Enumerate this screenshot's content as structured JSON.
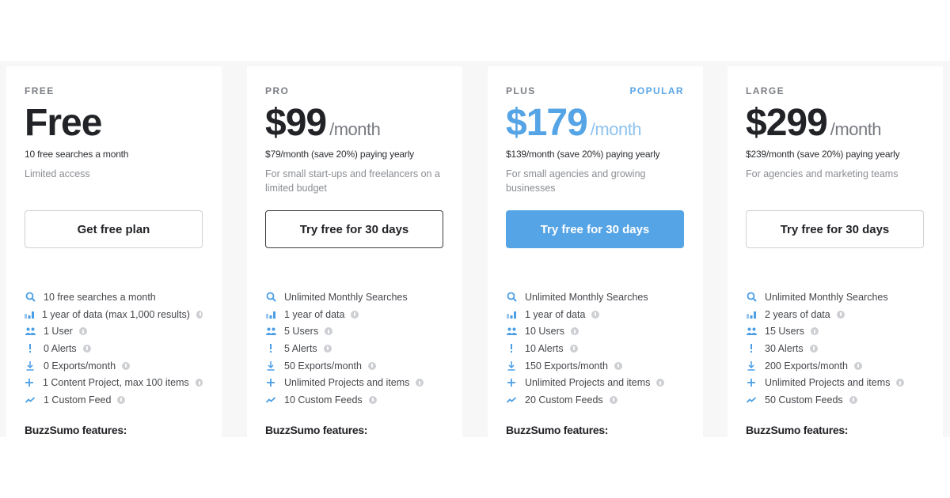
{
  "colors": {
    "accent": "#55a4e6",
    "text_dark": "#222327",
    "text_muted": "#8a8d93",
    "band_bg": "#f7f7f8"
  },
  "plans": [
    {
      "tier": "FREE",
      "price": "Free",
      "per": "",
      "yearly": "10 free searches a month",
      "description": "Limited access",
      "cta": "Get free plan",
      "features": [
        {
          "icon": "search-icon",
          "text": "10 free searches a month",
          "info": false
        },
        {
          "icon": "bar-chart-icon",
          "text": "1 year of data (max 1,000 results)",
          "info": true
        },
        {
          "icon": "users-icon",
          "text": "1 User",
          "info": true
        },
        {
          "icon": "exclamation-icon",
          "text": "0 Alerts",
          "info": true
        },
        {
          "icon": "download-icon",
          "text": "0 Exports/month",
          "info": true
        },
        {
          "icon": "plus-icon",
          "text": "1 Content Project, max 100 items",
          "info": true
        },
        {
          "icon": "trend-icon",
          "text": "1 Custom Feed",
          "info": true
        }
      ],
      "features_heading": "BuzzSumo features:"
    },
    {
      "tier": "PRO",
      "price": "$99",
      "per": "/month",
      "yearly": "$79/month (save 20%) paying yearly",
      "description": "For small start-ups and freelancers on a limited budget",
      "cta": "Try free for 30 days",
      "features": [
        {
          "icon": "search-icon",
          "text": "Unlimited Monthly Searches",
          "info": false
        },
        {
          "icon": "bar-chart-icon",
          "text": "1 year of data",
          "info": true
        },
        {
          "icon": "users-icon",
          "text": "5 Users",
          "info": true
        },
        {
          "icon": "exclamation-icon",
          "text": "5 Alerts",
          "info": true
        },
        {
          "icon": "download-icon",
          "text": "50 Exports/month",
          "info": true
        },
        {
          "icon": "plus-icon",
          "text": "Unlimited Projects and items",
          "info": true
        },
        {
          "icon": "trend-icon",
          "text": "10 Custom Feeds",
          "info": true
        }
      ],
      "features_heading": "BuzzSumo features:"
    },
    {
      "tier": "PLUS",
      "badge": "POPULAR",
      "price": "$179",
      "per": "/month",
      "yearly": "$139/month (save 20%) paying yearly",
      "description": "For small agencies and growing businesses",
      "cta": "Try free for 30 days",
      "features": [
        {
          "icon": "search-icon",
          "text": "Unlimited Monthly Searches",
          "info": false
        },
        {
          "icon": "bar-chart-icon",
          "text": "1 year of data",
          "info": true
        },
        {
          "icon": "users-icon",
          "text": "10 Users",
          "info": true
        },
        {
          "icon": "exclamation-icon",
          "text": "10 Alerts",
          "info": true
        },
        {
          "icon": "download-icon",
          "text": "150 Exports/month",
          "info": true
        },
        {
          "icon": "plus-icon",
          "text": "Unlimited Projects and items",
          "info": true
        },
        {
          "icon": "trend-icon",
          "text": "20 Custom Feeds",
          "info": true
        }
      ],
      "features_heading": "BuzzSumo features:"
    },
    {
      "tier": "LARGE",
      "price": "$299",
      "per": "/month",
      "yearly": "$239/month (save 20%) paying yearly",
      "description": "For agencies and marketing teams",
      "cta": "Try free for 30 days",
      "features": [
        {
          "icon": "search-icon",
          "text": "Unlimited Monthly Searches",
          "info": false
        },
        {
          "icon": "bar-chart-icon",
          "text": "2 years of data",
          "info": true
        },
        {
          "icon": "users-icon",
          "text": "15 Users",
          "info": true
        },
        {
          "icon": "exclamation-icon",
          "text": "30 Alerts",
          "info": true
        },
        {
          "icon": "download-icon",
          "text": "200 Exports/month",
          "info": true
        },
        {
          "icon": "plus-icon",
          "text": "Unlimited Projects and items",
          "info": true
        },
        {
          "icon": "trend-icon",
          "text": "50 Custom Feeds",
          "info": true
        }
      ],
      "features_heading": "BuzzSumo features:"
    }
  ]
}
